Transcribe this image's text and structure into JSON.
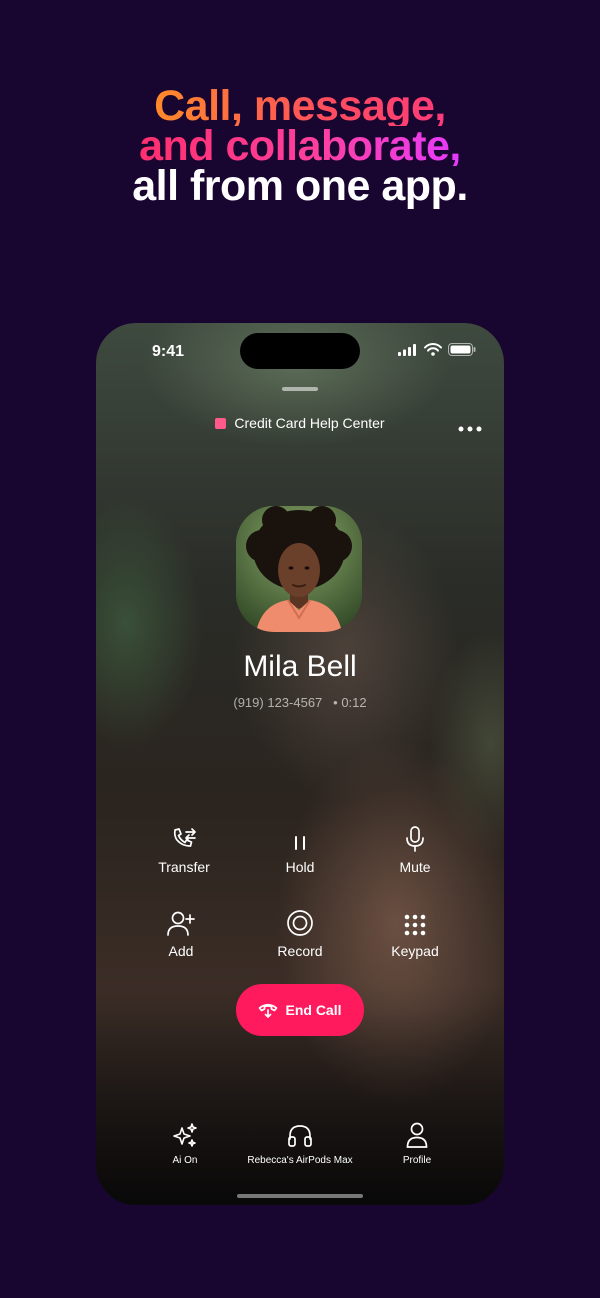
{
  "headline": {
    "line1": "Call, message,",
    "line2": "and collaborate,",
    "line3": "all from one app."
  },
  "status_bar": {
    "time": "9:41"
  },
  "call": {
    "context_label": "Credit Card Help Center",
    "context_color": "#ff5a8a",
    "contact_name": "Mila Bell",
    "phone_number": "(919) 123-4567",
    "separator": "•",
    "duration": "0:12"
  },
  "controls": [
    {
      "label": "Transfer",
      "icon": "phone-transfer-icon"
    },
    {
      "label": "Hold",
      "icon": "pause-icon"
    },
    {
      "label": "Mute",
      "icon": "microphone-icon"
    },
    {
      "label": "Add",
      "icon": "add-user-icon"
    },
    {
      "label": "Record",
      "icon": "record-icon"
    },
    {
      "label": "Keypad",
      "icon": "keypad-icon"
    }
  ],
  "end_call": {
    "label": "End Call",
    "color": "#ff1a5e"
  },
  "dock": [
    {
      "label": "Ai On",
      "icon": "sparkles-icon"
    },
    {
      "label": "Rebecca's AirPods Max",
      "icon": "headphones-icon"
    },
    {
      "label": "Profile",
      "icon": "person-icon"
    }
  ]
}
